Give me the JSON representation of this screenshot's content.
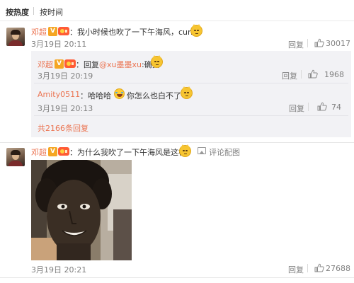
{
  "sort_tabs": {
    "hot": "按热度",
    "time": "按时间"
  },
  "comments": [
    {
      "user": "邓超",
      "text_before": "：我小时候也吹了一下午海风，cun了",
      "time": "3月19日 20:11",
      "reply_label": "回复",
      "likes": "30017",
      "replies": [
        {
          "user": "邓超",
          "prefix": "：回复",
          "mention": "@xu墨墨xu",
          "text": ":确实",
          "time": "3月19日 20:19",
          "reply_label": "回复",
          "likes": "1968"
        },
        {
          "user": "Amity0511",
          "text_a": "：哈哈哈",
          "text_b": "你怎么也白不了",
          "time": "3月19日 20:13",
          "reply_label": "回复",
          "likes": "74"
        }
      ],
      "more_replies": "共2166条回复"
    },
    {
      "user": "邓超",
      "text": "：为什么我吹了一下午海风是这样",
      "comment_with_pic": "评论配图",
      "time": "3月19日 20:21",
      "reply_label": "回复",
      "likes": "27688"
    }
  ],
  "icons": {
    "verified": "V",
    "avatar": "avatar-icon",
    "vip": "vip-icon",
    "doge": "doge-emoji-icon",
    "laugh": "laugh-cry-emoji-icon",
    "thumb": "thumbs-up-icon",
    "picture": "picture-icon"
  },
  "colors": {
    "link": "#eb7350",
    "meta": "#808080",
    "subpanel": "#f2f2f5"
  }
}
